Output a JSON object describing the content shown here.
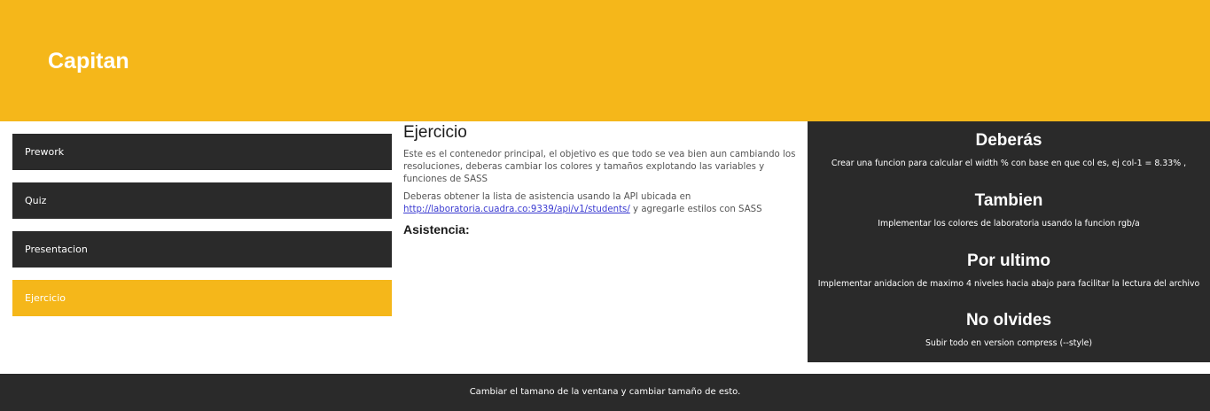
{
  "header": {
    "title": "Capitan"
  },
  "sidebar": {
    "items": [
      {
        "label": "Prework"
      },
      {
        "label": "Quiz"
      },
      {
        "label": "Presentacion"
      },
      {
        "label": "Ejercicio"
      }
    ]
  },
  "main": {
    "title": "Ejercicio",
    "paragraph1": "Este es el contenedor principal, el objetivo es que todo se vea bien aun cambiando los resoluciones, deberas cambiar los colores y tamaños explotando las variables y funciones de SASS",
    "paragraph2_before": "Deberas obtener la lista de asistencia usando la API ubicada en",
    "api_link": "http://laboratoria.cuadra.co:9339/api/v1/students/",
    "paragraph2_after": " y agregarle estilos con SASS",
    "subtitle": "Asistencia:"
  },
  "aside": {
    "sections": [
      {
        "title": "Deberás",
        "text": "Crear una funcion para calcular el width % con base en que col es, ej col-1 = 8.33% ,"
      },
      {
        "title": "Tambien",
        "text": "Implementar los colores de laboratoria usando la funcion rgb/a"
      },
      {
        "title": "Por ultimo",
        "text": "Implementar anidacion de maximo 4 niveles hacia abajo para facilitar la lectura del archivo"
      },
      {
        "title": "No olvides",
        "text": "Subir todo en version compress (--style)"
      }
    ]
  },
  "footer": {
    "text": "Cambiar el tamano de la ventana y cambiar tamaño de esto."
  },
  "colors": {
    "accent": "#f5b71a",
    "dark": "#2a2a2a",
    "link": "#3b3bd1"
  }
}
